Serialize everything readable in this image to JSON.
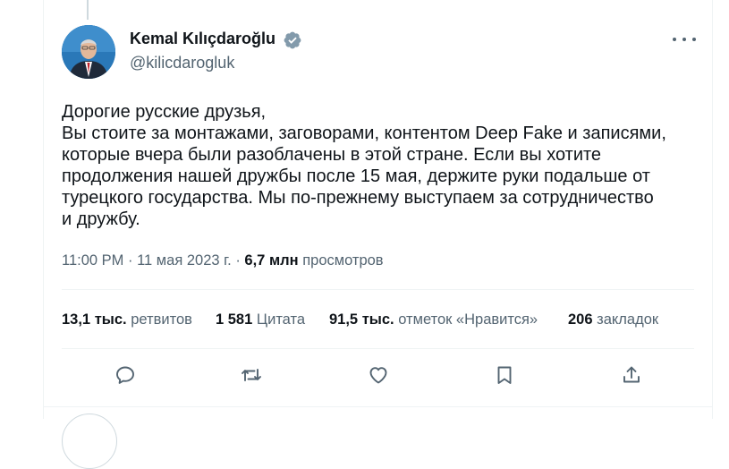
{
  "tweet": {
    "author_name": "Kemal Kılıçdaroğlu",
    "handle": "@kilicdarogluk",
    "text_lines": [
      "Дорогие русские друзья,",
      "Вы стоите за монтажами, заговорами, контентом Deep Fake и записями,",
      "которые вчера были разоблачены в этой стране. Если вы хотите",
      "продолжения нашей дружбы после 15 мая, держите руки подальше от",
      "турецкого государства. Мы по-прежнему выступаем за сотрудничество",
      "и дружбу."
    ],
    "time": "11:00 PM",
    "date": "11 мая 2023 г.",
    "views_count": "6,7 млн",
    "views_label": "просмотров"
  },
  "stats": {
    "retweets_count": "13,1 тыс.",
    "retweets_label": "ретвитов",
    "quotes_count": "1 581",
    "quotes_label": "Цитата",
    "likes_count": "91,5 тыс.",
    "likes_label": "отметок «Нравится»",
    "bookmarks_count": "206",
    "bookmarks_label": "закладок"
  },
  "icons": {
    "verified": "verified-badge-icon",
    "more": "more-horizontal-icon",
    "reply": "reply-icon",
    "retweet": "retweet-icon",
    "like": "heart-icon",
    "bookmark": "bookmark-icon",
    "share": "share-icon"
  },
  "colors": {
    "text_primary": "#0f1419",
    "text_secondary": "#536471",
    "divider": "#eff3f4",
    "verified_badge": "#829aab"
  }
}
